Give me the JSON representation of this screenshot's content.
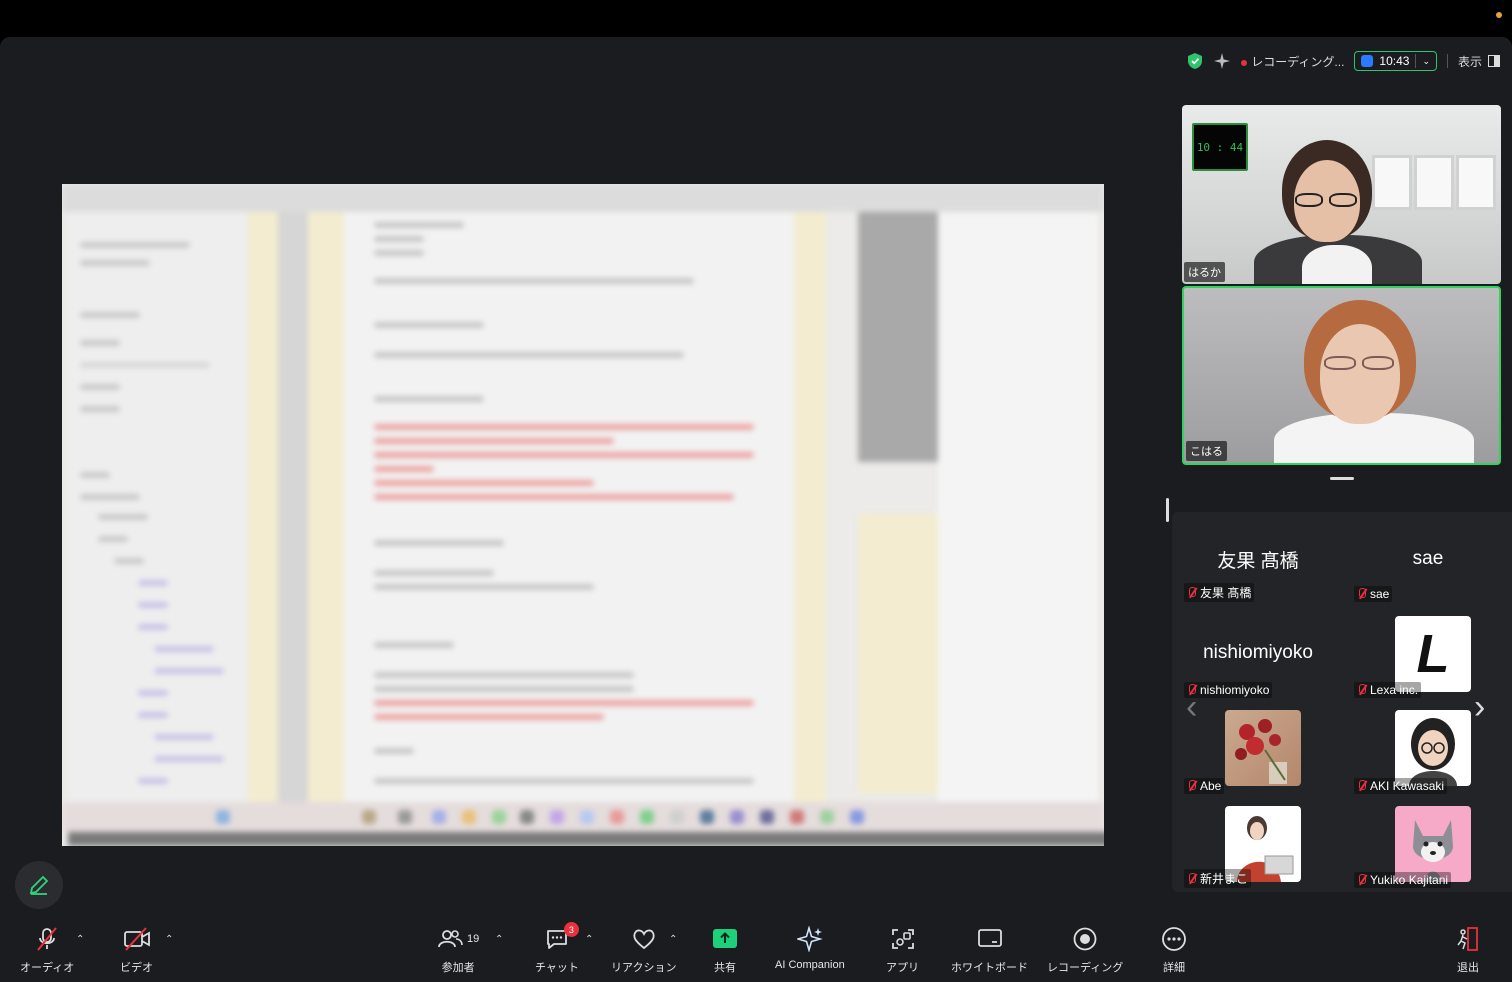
{
  "status": {
    "recording_label": "レコーディング...",
    "timer": "10:43",
    "view_label": "表示"
  },
  "videos": [
    {
      "name": "はるか",
      "overlay_clock": "10 : 44"
    },
    {
      "name": "こはる"
    }
  ],
  "gallery": [
    {
      "display": "友果 髙橋",
      "label": "友果 髙橋",
      "type": "name"
    },
    {
      "display": "sae",
      "label": "sae",
      "type": "name"
    },
    {
      "display": "nishiomiyoko",
      "label": "nishiomiyoko",
      "type": "name"
    },
    {
      "display": "L",
      "label": "Lexa inc.",
      "type": "logo"
    },
    {
      "label": "Abe",
      "type": "photo"
    },
    {
      "label": "AKI Kawasaki",
      "type": "illustration"
    },
    {
      "label": "新井まこ",
      "type": "illustration"
    },
    {
      "label": "Yukiko Kajitani",
      "type": "illustration"
    }
  ],
  "toolbar": {
    "audio": "オーディオ",
    "video": "ビデオ",
    "participants": "参加者",
    "participants_count": "19",
    "chat": "チャット",
    "chat_badge": "3",
    "reactions": "リアクション",
    "share": "共有",
    "ai_companion": "AI Companion",
    "apps": "アプリ",
    "whiteboard": "ホワイトボード",
    "recording": "レコーディング",
    "more": "詳細",
    "leave": "退出"
  },
  "colors": {
    "accent_green": "#2fd35f",
    "share_green": "#1fd07a",
    "mute_red": "#e8303e",
    "background": "#1b1c1f"
  }
}
